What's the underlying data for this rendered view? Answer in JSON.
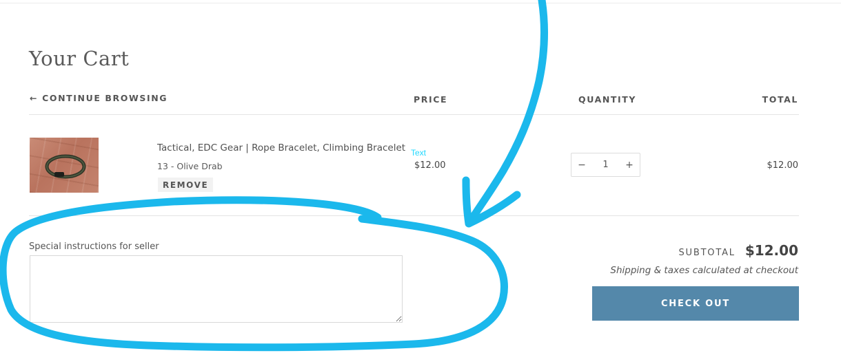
{
  "page": {
    "title": "Your Cart"
  },
  "nav": {
    "continue_label": "CONTINUE BROWSING",
    "arrow": "←"
  },
  "columns": {
    "price": "PRICE",
    "quantity": "QUANTITY",
    "total": "TOTAL"
  },
  "items": [
    {
      "name": "Tactical, EDC Gear | Rope Bracelet, Climbing Bracelet",
      "variant": "13 - Olive Drab",
      "remove_label": "REMOVE",
      "price": "$12.00",
      "quantity": "1",
      "total": "$12.00",
      "image_icon": "rope-bracelet-photo"
    }
  ],
  "annotation": {
    "text": "Text",
    "color": "#1fd8ff"
  },
  "qty_controls": {
    "minus": "−",
    "plus": "+"
  },
  "note": {
    "label": "Special instructions for seller",
    "value": ""
  },
  "summary": {
    "subtotal_label": "SUBTOTAL",
    "subtotal_value": "$12.00",
    "shipping_note": "Shipping & taxes calculated at checkout",
    "checkout_label": "CHECK OUT"
  },
  "colors": {
    "accent": "#5488aa",
    "annotation_stroke": "#1bb8ec"
  }
}
